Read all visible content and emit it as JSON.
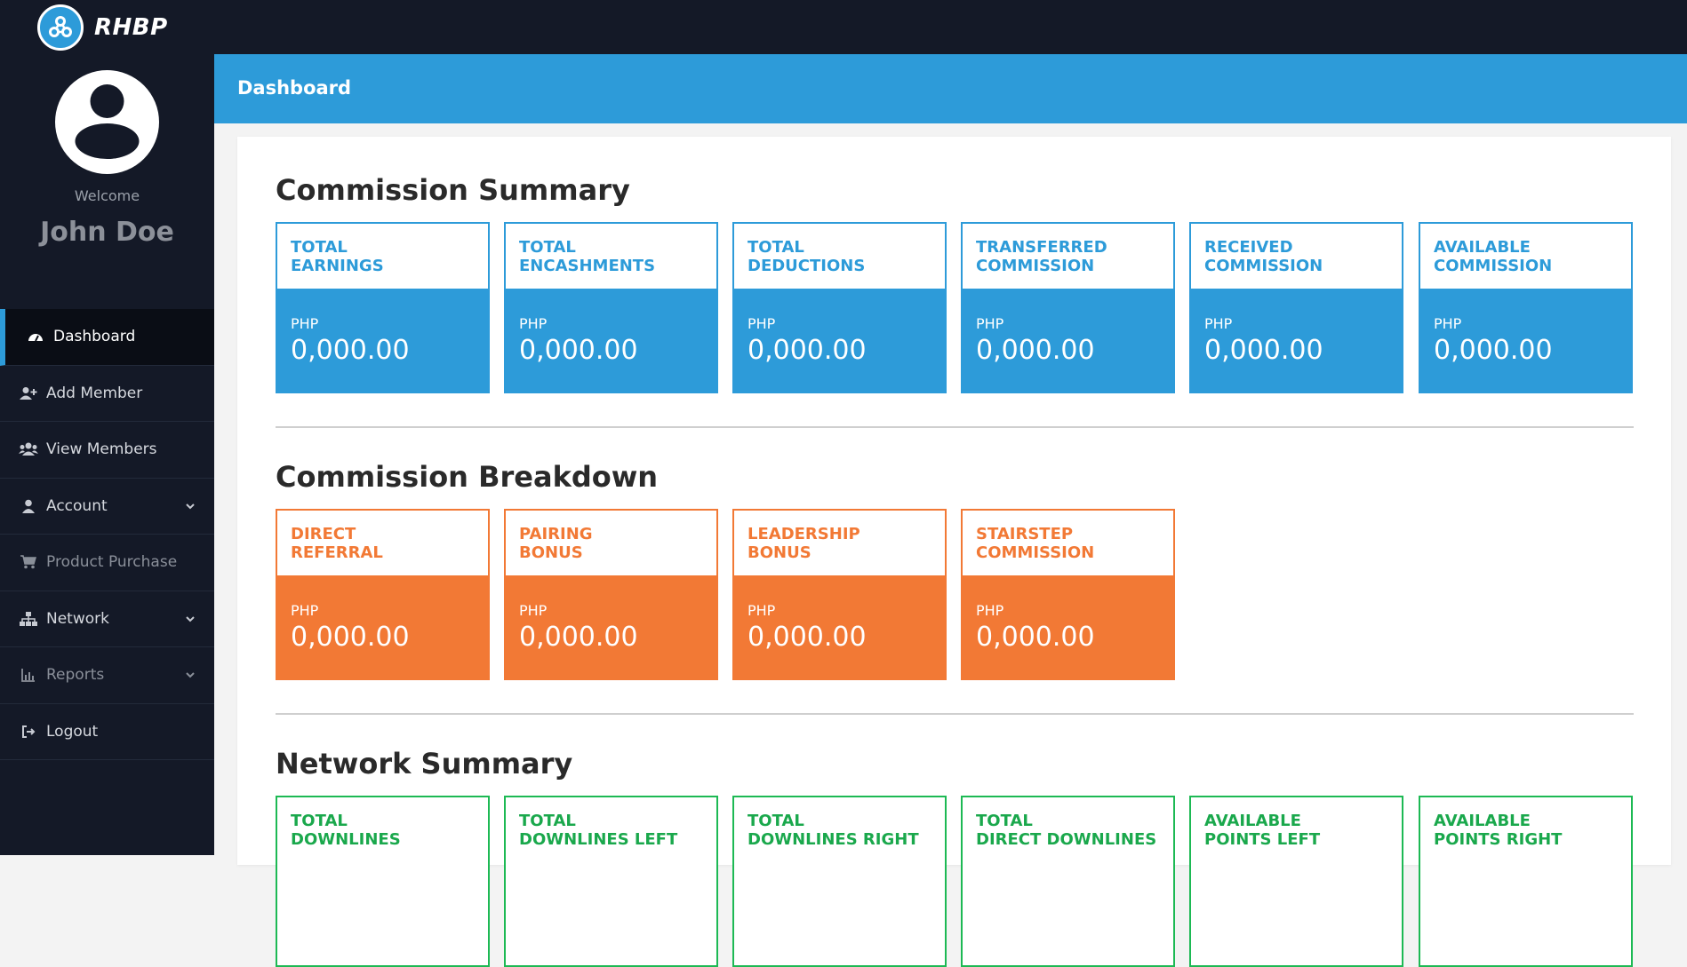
{
  "brand": {
    "name": "RHBP",
    "logo_icon": "molecule-icon"
  },
  "sidebar": {
    "welcome": "Welcome",
    "username": "John Doe",
    "items": [
      {
        "label": "Dashboard",
        "icon": "gauge-icon",
        "active": true
      },
      {
        "label": "Add Member",
        "icon": "user-plus-icon"
      },
      {
        "label": "View Members",
        "icon": "users-icon"
      },
      {
        "label": "Account",
        "icon": "user-icon",
        "chevron": true
      },
      {
        "label": "Product Purchase",
        "icon": "cart-icon"
      },
      {
        "label": "Network",
        "icon": "sitemap-icon",
        "chevron": true
      },
      {
        "label": "Reports",
        "icon": "chart-icon",
        "chevron": true
      },
      {
        "label": "Logout",
        "icon": "sign-out-icon"
      }
    ]
  },
  "header": {
    "title": "Dashboard"
  },
  "commission_summary": {
    "title": "Commission Summary",
    "tiles": [
      {
        "line1": "TOTAL",
        "line2": "EARNINGS",
        "currency": "PHP",
        "amount": "0,000.00"
      },
      {
        "line1": "TOTAL",
        "line2": "ENCASHMENTS",
        "currency": "PHP",
        "amount": "0,000.00"
      },
      {
        "line1": "TOTAL",
        "line2": "DEDUCTIONS",
        "currency": "PHP",
        "amount": "0,000.00"
      },
      {
        "line1": "TRANSFERRED",
        "line2": "COMMISSION",
        "currency": "PHP",
        "amount": "0,000.00"
      },
      {
        "line1": "RECEIVED",
        "line2": "COMMISSION",
        "currency": "PHP",
        "amount": "0,000.00"
      },
      {
        "line1": "AVAILABLE",
        "line2": "COMMISSION",
        "currency": "PHP",
        "amount": "0,000.00"
      }
    ]
  },
  "commission_breakdown": {
    "title": "Commission Breakdown",
    "tiles": [
      {
        "line1": "DIRECT",
        "line2": "REFERRAL",
        "currency": "PHP",
        "amount": "0,000.00"
      },
      {
        "line1": "PAIRING",
        "line2": "BONUS",
        "currency": "PHP",
        "amount": "0,000.00"
      },
      {
        "line1": "LEADERSHIP",
        "line2": "BONUS",
        "currency": "PHP",
        "amount": "0,000.00"
      },
      {
        "line1": "STAIRSTEP",
        "line2": "COMMISSION",
        "currency": "PHP",
        "amount": "0,000.00"
      }
    ]
  },
  "network_summary": {
    "title": "Network Summary",
    "tiles": [
      {
        "line1": "TOTAL",
        "line2": "DOWNLINES"
      },
      {
        "line1": "TOTAL",
        "line2": "DOWNLINES LEFT"
      },
      {
        "line1": "TOTAL",
        "line2": "DOWNLINES RIGHT"
      },
      {
        "line1": "TOTAL",
        "line2": "DIRECT DOWNLINES"
      },
      {
        "line1": "AVAILABLE",
        "line2": "POINTS LEFT"
      },
      {
        "line1": "AVAILABLE",
        "line2": "POINTS RIGHT"
      }
    ]
  },
  "colors": {
    "blue": "#2d9bd9",
    "orange": "#f27935",
    "green": "#1db954",
    "sidebar": "#141927"
  }
}
